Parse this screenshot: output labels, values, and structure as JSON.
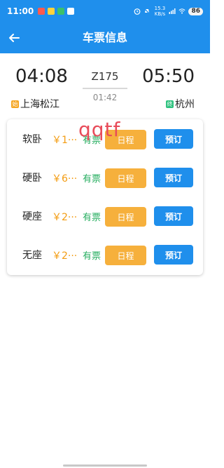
{
  "status_bar": {
    "time": "11:00",
    "network_speed": "15.3 KB/s",
    "battery": "86"
  },
  "header": {
    "title": "车票信息"
  },
  "train": {
    "departure_time": "04:08",
    "arrival_time": "05:50",
    "number": "Z175",
    "duration": "01:42",
    "departure_station": "上海松江",
    "arrival_station": "杭州",
    "start_tag": "始",
    "end_tag": "终"
  },
  "watermark": "qqtf",
  "seats": [
    {
      "name": "软卧",
      "price": "￥1···",
      "availability": "有票",
      "schedule_label": "日程",
      "book_label": "预订"
    },
    {
      "name": "硬卧",
      "price": "￥6···",
      "availability": "有票",
      "schedule_label": "日程",
      "book_label": "预订"
    },
    {
      "name": "硬座",
      "price": "￥2···",
      "availability": "有票",
      "schedule_label": "日程",
      "book_label": "预订"
    },
    {
      "name": "无座",
      "price": "￥2···",
      "availability": "有票",
      "schedule_label": "日程",
      "book_label": "预订"
    }
  ],
  "colors": {
    "primary": "#1f8fec",
    "schedule_button": "#f6b03c",
    "price": "#f39c12",
    "availability": "#27ae60",
    "watermark": "#e84c5a"
  },
  "icons": {
    "back": "arrow-left-icon"
  }
}
